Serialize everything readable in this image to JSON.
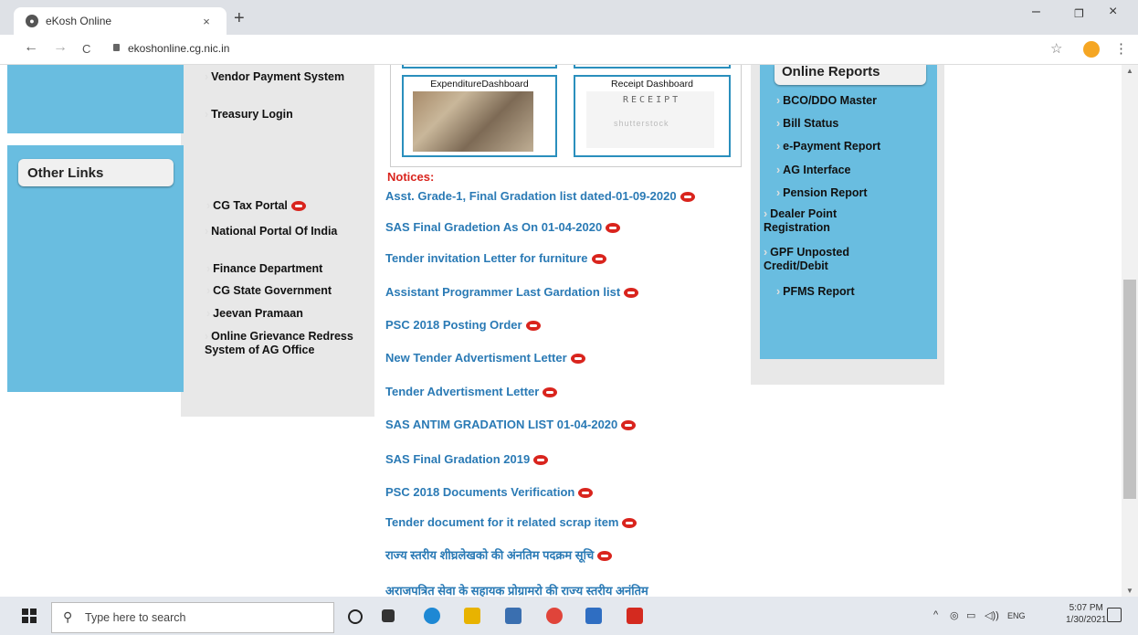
{
  "browser": {
    "tab_title": "eKosh Online",
    "tab_close": "×",
    "new_tab": "+",
    "url": "ekoshonline.cg.nic.in",
    "nav": {
      "back": "←",
      "forward": "→",
      "reload": "C"
    },
    "window": {
      "minimize": "–",
      "maximize": "ㅁ",
      "close": "×"
    }
  },
  "left_sidebar": {
    "top_items": [
      {
        "label": "Vendor Payment System"
      },
      {
        "label": "Treasury Login"
      }
    ],
    "other_links_heading": "Other Links",
    "other_links": [
      {
        "label": "CG Tax Portal",
        "new": true
      },
      {
        "label": "National Portal Of India",
        "new": false
      },
      {
        "label": "Finance Department",
        "new": false
      },
      {
        "label": "CG State Government",
        "new": false
      },
      {
        "label": "Jeevan Pramaan",
        "new": false
      },
      {
        "label": "Online Grievance Redress System of AG Office",
        "new": false
      }
    ]
  },
  "dashboards": [
    {
      "title": "ExpenditureDashboard",
      "image": "currency-notes"
    },
    {
      "title": "Receipt Dashboard",
      "image": "receipt-stamp",
      "img_text": "RECEIPT",
      "watermark": "shutterstock"
    }
  ],
  "notices": {
    "label": "Notices:",
    "items": [
      "Asst. Grade-1, Final Gradation list dated-01-09-2020",
      "SAS Final Gradetion As On 01-04-2020",
      "Tender invitation Letter for furniture",
      "Assistant Programmer Last Gardation list",
      "PSC 2018 Posting Order",
      "New Tender Advertisment Letter",
      "Tender Advertisment Letter",
      "SAS ANTIM GRADATION LIST 01-04-2020",
      "SAS Final Gradation 2019",
      "PSC 2018 Documents Verification",
      "Tender document for it related scrap item",
      "राज्य स्तरीय शीघ्रलेखको की अंनतिम पदक्रम सूचि",
      "अराजपत्रित सेवा के सहायक प्रोग्रामरो की राज्य स्तरीय अनंतिम"
    ]
  },
  "online_reports": {
    "heading": "Online Reports",
    "items": [
      "BCO/DDO Master",
      "Bill Status",
      "e-Payment Report",
      "AG Interface",
      "Pension Report",
      "Dealer Point Registration",
      "GPF Unposted Credit/Debit",
      "PFMS Report"
    ]
  },
  "taskbar": {
    "search_placeholder": "Type here to search",
    "language": "ENG",
    "time": "5:07 PM",
    "date": "1/30/2021"
  }
}
